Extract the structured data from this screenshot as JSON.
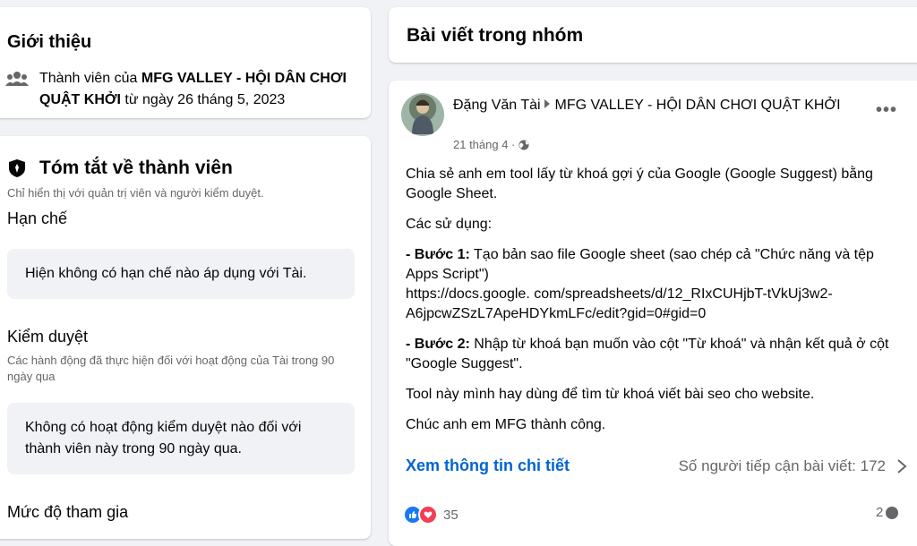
{
  "intro": {
    "title": "Giới thiệu",
    "member_prefix": "Thành viên của ",
    "group_name": "MFG VALLEY - HỘI DÂN CHƠI QUẬT KHỞI",
    "member_since": " từ ngày 26 tháng 5, 2023"
  },
  "summary": {
    "title": "Tóm tắt về thành viên",
    "subtitle": "Chỉ hiển thị với quản trị viên và người kiểm duyệt.",
    "restrictions_title": "Hạn chế",
    "restrictions_text": "Hiện không có hạn chế nào áp dụng với Tài.",
    "moderation_title": "Kiểm duyệt",
    "moderation_desc": "Các hành động đã thực hiện đối với hoạt động của Tài trong 90 ngày qua",
    "moderation_text": "Không có hoạt động kiểm duyệt nào đối với thành viên này trong 90 ngày qua.",
    "participation_title": "Mức độ tham gia"
  },
  "group_posts": {
    "title": "Bài viết trong nhóm"
  },
  "post": {
    "author": "Đặng Văn Tài",
    "group": "MFG VALLEY - HỘI DÂN CHƠI QUẬT KHỞI",
    "date": "21 tháng 4 ·",
    "more": "•••",
    "p1": "Chia sẻ anh em tool lấy từ khoá gợi ý của Google (Google Suggest) bằng Google Sheet.",
    "p2": "Các sử dụng:",
    "step1_label": "- Bước 1:",
    "step1_text": " Tạo bản sao file Google sheet (sao chép cả \"Chức năng và tệp Apps Script\")",
    "step1_url": "https://docs.google. com/spreadsheets/d/12_RIxCUHjbT-tVkUj3w2-A6jpcwZSzL7ApeHDYkmLFc/edit?gid=0#gid=0",
    "step2_label": "- Bước 2:",
    "step2_text": " Nhập từ khoá bạn muốn vào cột \"Từ khoá\" và nhận kết quả ở cột \"Google Suggest\".",
    "p5": "Tool này mình hay dùng để tìm từ khoá viết bài seo cho website.",
    "p6": "Chúc anh em MFG thành công.",
    "see_more": "Xem thông tin chi tiết",
    "reach_label": "Số người tiếp cận bài viết: 172",
    "reaction_count": "35",
    "comment_count": "2"
  },
  "colors": {
    "background": "#f0f2f5",
    "link": "#0064d1",
    "secondary_text": "#65676b",
    "like": "#1877f2",
    "love": "#f33e58"
  }
}
